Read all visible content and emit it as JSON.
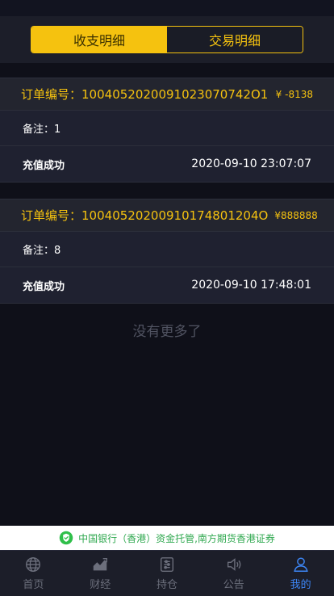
{
  "segment": {
    "tabs": [
      {
        "label": "收支明细",
        "active": true
      },
      {
        "label": "交易明细",
        "active": false
      }
    ]
  },
  "records": [
    {
      "order_label": "订单编号：",
      "order_no": "1004052020091023070742O1",
      "amount": "¥ -8138",
      "note_label": "备注：",
      "note_value": "1",
      "status": "充值成功",
      "time": "2020-09-10 23:07:07"
    },
    {
      "order_label": "订单编号：",
      "order_no": "10040520200910174801204O",
      "amount": "¥888888",
      "note_label": "备注：",
      "note_value": "8",
      "status": "充值成功",
      "time": "2020-09-10 17:48:01"
    }
  ],
  "no_more": "没有更多了",
  "banner": {
    "text": "中国银行（香港）资金托管,南方期货香港证券",
    "color": "#2fa84f"
  },
  "tabbar": [
    {
      "label": "首页",
      "icon": "globe-icon",
      "active": false
    },
    {
      "label": "财经",
      "icon": "chart-icon",
      "active": false
    },
    {
      "label": "持仓",
      "icon": "portfolio-icon",
      "active": false
    },
    {
      "label": "公告",
      "icon": "speaker-icon",
      "active": false
    },
    {
      "label": "我的",
      "icon": "user-icon",
      "active": true
    }
  ],
  "colors": {
    "accent": "#f5c20f",
    "active_tab": "#3d86f5",
    "background": "#0f1019"
  }
}
